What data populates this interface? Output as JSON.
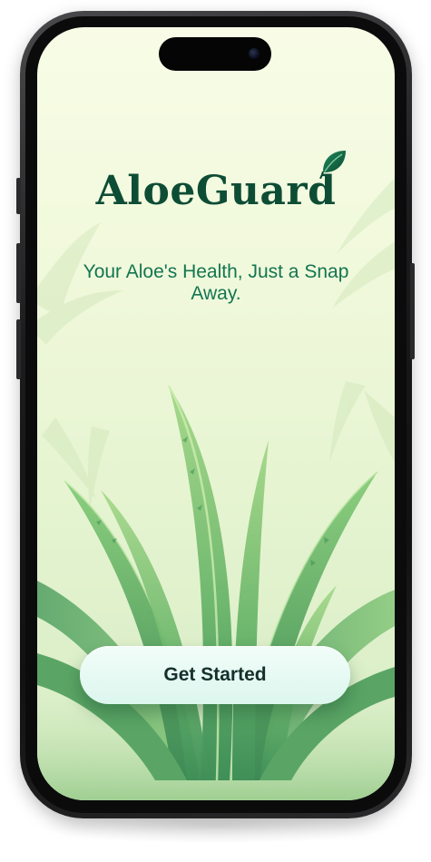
{
  "app": {
    "name": "AloeGuard",
    "tagline": "Your Aloe's Health, Just a Snap Away."
  },
  "cta": {
    "label": "Get Started"
  },
  "icons": {
    "logo_accent": "leaf-icon"
  },
  "colors": {
    "brand_dark_green": "#0e4d35",
    "tagline_green": "#137551",
    "button_bg": "#e4f8f1",
    "background_top": "#f8fce6",
    "background_bottom": "#d5ecc4",
    "aloe_green": "#5ea862"
  }
}
